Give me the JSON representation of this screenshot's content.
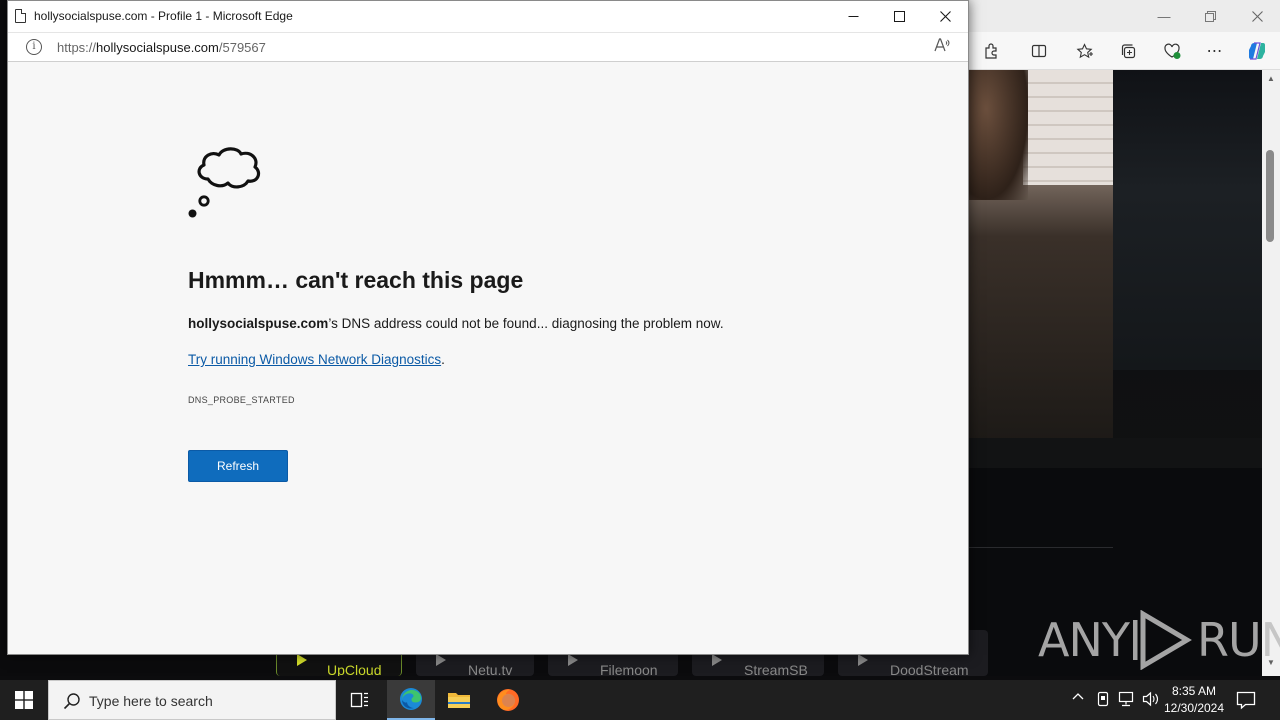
{
  "popup": {
    "window_title": "hollysocialspuse.com - Profile 1 - Microsoft Edge",
    "url_prefix": "https://",
    "url_host": "hollysocialspuse.com",
    "url_path": "/579567"
  },
  "error": {
    "title": "Hmmm… can't reach this page",
    "host": "hollysocialspuse.com",
    "desc_rest": "’s DNS address could not be found... diagnosing the problem now.",
    "link_text": "Try running Windows Network Diagnostics",
    "link_suffix": ".",
    "code": "DNS_PROBE_STARTED",
    "refresh_label": "Refresh"
  },
  "background": {
    "servers": [
      {
        "name": "UpCloud",
        "active": true
      },
      {
        "name": "Netu.tv",
        "active": false
      },
      {
        "name": "Filemoon",
        "active": false
      },
      {
        "name": "StreamSB",
        "active": false
      },
      {
        "name": "DoodStream",
        "active": false
      }
    ]
  },
  "taskbar": {
    "search_placeholder": "Type here to search",
    "time": "8:35 AM",
    "date": "12/30/2024"
  },
  "watermark": {
    "left": "ANY",
    "right": "RUN"
  }
}
